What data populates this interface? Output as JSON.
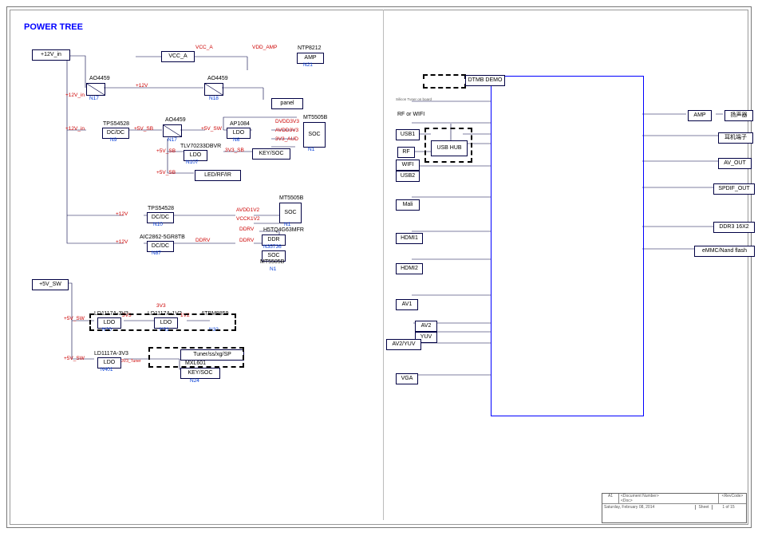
{
  "title": "POWER TREE",
  "titleblock": {
    "size": "A1",
    "docnum": "<Document Number>",
    "doc2": "<Doc>",
    "date": "Saturday, February 08, 2014",
    "sheet_word": "Sheet",
    "sheet_of": "1   of   15",
    "rev": "<RevCode>"
  },
  "inputs": {
    "v12": "+12V_in",
    "v5sw": "+5V_SW"
  },
  "blocks": {
    "VCC_A": "VCC_A",
    "N17a": "N17",
    "AO4459a": "AO4459",
    "N18": "N18",
    "AO4459b": "AO4459",
    "N17b": "N17",
    "AO4459c": "AO4459",
    "N9": "N9",
    "TPS54528a": "TPS54528",
    "DCDCa": "DC/DC",
    "N6": "N6",
    "AP1084": "AP1084",
    "LDOa": "LDO",
    "N107": "N107",
    "TLV70233DBVR": "TLV70233DBVR",
    "LDOb": "LDO",
    "KEY_SOC1": "KEY/SOC",
    "LED": "LED/RF/IR",
    "N10": "N10",
    "TPS54528b": "TPS54528",
    "DCDCb": "DC/DC",
    "N87": "N87",
    "AIC": "AIC2862-5GR8TB",
    "DCDCc": "DC/DC",
    "MT5505Ba": "MT5505B",
    "N1a": "N1",
    "SOCa": "SOC",
    "MT5505Bb": "MT5505B",
    "N1b": "N1",
    "SOCb": "SOC",
    "DDR": "DDR",
    "H5TQ": "H5TQ4G63MFR",
    "N35736": "N35736",
    "SOCc": "SOC",
    "MT5505Bc": "MT5505B",
    "N1c": "N1",
    "N21": "N21",
    "NTP8212": "NTP8212",
    "AMPa": "AMP",
    "panel": "panel",
    "N20": "N20",
    "LD1117a": "LD1117A-3V3",
    "LDOc": "LDO",
    "N31": "N31",
    "LD1117b": "LD1117A-1V2",
    "LDOd": "LDO",
    "N32": "N32",
    "ATB": "ATBM8859",
    "N401": "N401",
    "LD1117c": "LD1117A-3V3",
    "LDOe": "LDO",
    "N24": "N24",
    "NXE": "MXL601",
    "Tuner": "Tuner/ss/xg/SP",
    "KEY_SOC2": "KEY/SOC"
  },
  "nets": {
    "VCC_A": "VCC_A",
    "VDD_AMP": "VDD_AMP",
    "v12in": "+12V_in",
    "v12": "+12V",
    "v5sb": "+5V_SB",
    "v5sw": "+5V_SW",
    "v3v3sb": "3V3_SB",
    "DVDD3V3": "DVDD3V3",
    "AVDD3V3": "AVDD3V3",
    "AVDD1V2": "AVDD1V2",
    "VCCK1V2": "VCCK1V2",
    "DDRV": "DDRV",
    "V3V3_AUD": "3V3_AUD",
    "v3v3": "3V3",
    "v1v2": "1V2",
    "v3v3tuner": "3V3_Tuner"
  },
  "right": {
    "dtmb": "DTMB DEMO",
    "silicon": "Silicon Tuner on board",
    "rfwifi": "RF  or  WIFI",
    "usb1": "USB1",
    "rf": "RF",
    "wifi": "WIFI",
    "usbhub": "USB HUB",
    "usb2": "USB2",
    "mali": "Mali",
    "hdmi1": "HDMI1",
    "hdmi2": "HDMI2",
    "av1": "AV1",
    "av2": "AV2",
    "yuv": "YUV",
    "av2yuv": "AV2/YUV",
    "vga": "VGA",
    "amp": "AMP",
    "speaker": "扬声器",
    "headphone": "耳机端子",
    "avout": "AV_OUT",
    "spdif": "SPDIF_OUT",
    "ddr3": "DDR3 16X2",
    "emmc": "eMMC/Nand flash"
  }
}
